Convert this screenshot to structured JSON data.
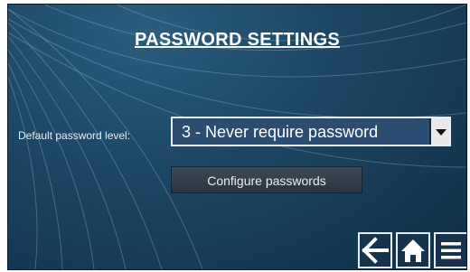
{
  "page": {
    "title": "PASSWORD SETTINGS"
  },
  "password_level": {
    "label": "Default password level:",
    "selected": "3 - Never require password"
  },
  "actions": {
    "configure_label": "Configure passwords"
  },
  "nav": {
    "back_icon": "arrow-left-icon",
    "home_icon": "home-icon",
    "menu_icon": "hamburger-menu-icon"
  },
  "colors": {
    "background": "#1b4562",
    "select_bg": "#2c4d72",
    "text": "#ffffff"
  }
}
